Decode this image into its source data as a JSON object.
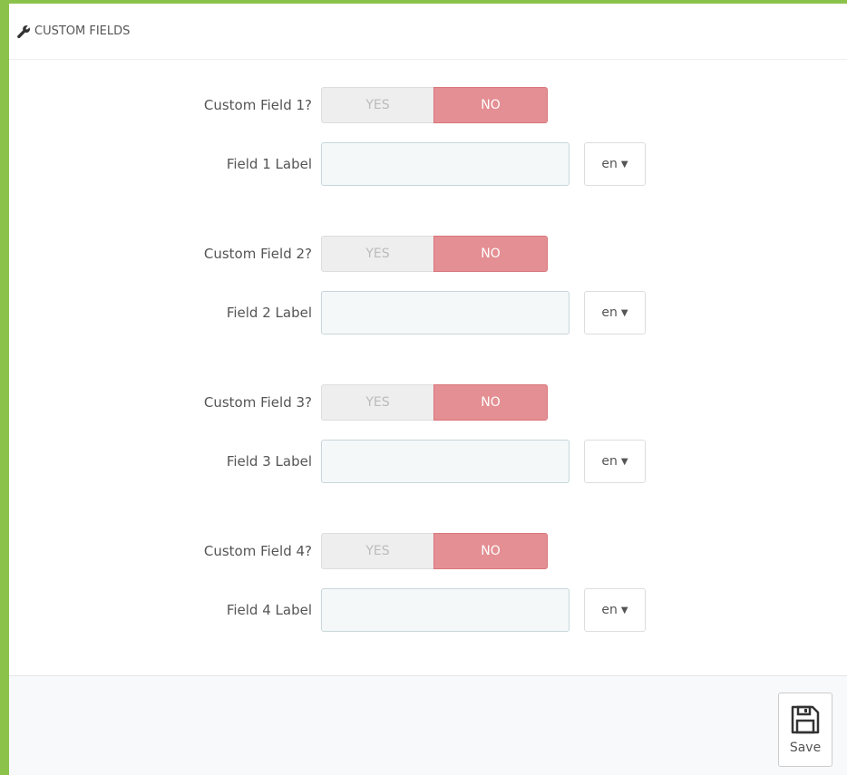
{
  "panel": {
    "title": "CUSTOM FIELDS",
    "header_icon": "wrench-icon"
  },
  "fields": [
    {
      "toggle_label": "Custom Field 1?",
      "yes": "YES",
      "no": "NO",
      "selected": "NO",
      "label_label": "Field 1 Label",
      "value": "",
      "lang": "en"
    },
    {
      "toggle_label": "Custom Field 2?",
      "yes": "YES",
      "no": "NO",
      "selected": "NO",
      "label_label": "Field 2 Label",
      "value": "",
      "lang": "en"
    },
    {
      "toggle_label": "Custom Field 3?",
      "yes": "YES",
      "no": "NO",
      "selected": "NO",
      "label_label": "Field 3 Label",
      "value": "",
      "lang": "en"
    },
    {
      "toggle_label": "Custom Field 4?",
      "yes": "YES",
      "no": "NO",
      "selected": "NO",
      "label_label": "Field 4 Label",
      "value": "",
      "lang": "en"
    }
  ],
  "footer": {
    "save_label": "Save",
    "save_icon": "floppy-disk-icon"
  },
  "colors": {
    "accent_border": "#8bc34a",
    "no_active": "#e48f93",
    "yes_inactive": "#eeeeee"
  }
}
